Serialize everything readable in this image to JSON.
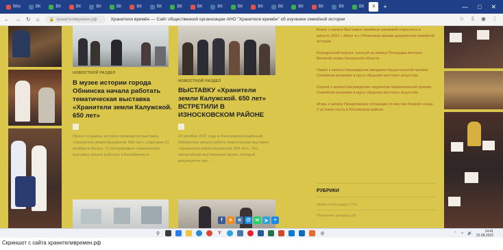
{
  "browser": {
    "tabs": [
      {
        "label": "ВКи"
      },
      {
        "label": "ВК"
      },
      {
        "label": "ВК"
      },
      {
        "label": "ВК"
      },
      {
        "label": "ВК"
      },
      {
        "label": "ВК"
      },
      {
        "label": "ВК"
      },
      {
        "label": "ВК"
      },
      {
        "label": "ВК"
      },
      {
        "label": "ВК"
      },
      {
        "label": "ВК"
      },
      {
        "label": "ВК"
      },
      {
        "label": "ВК"
      },
      {
        "label": "ВК"
      },
      {
        "label": "ВК"
      },
      {
        "label": "ВК"
      },
      {
        "label": "ВК"
      },
      {
        "label": "ВК"
      }
    ],
    "active_tab": "Х",
    "window_controls": {
      "minimize": "—",
      "maximize": "□",
      "close": "✕"
    },
    "url": "хранителивремен.рф",
    "page_title": "Хранители времён — Сайт общественной организации АНО \"Хранители времён\" об изучении семейной истории"
  },
  "articles": [
    {
      "category": "НОВОСТНОЙ РАЗДЕЛ",
      "title": "В музее истории города Обнинска начала работать тематическая выставка «Хранители земли Калужской. 650 лет»",
      "excerpt": "Проект, в рамках которого проводится выставка «Хранители земли Калужской. 650 лет», стартовал 21 октября в Калуге. 12 интерактивно-тематических выставка начала работать в Балабаново и ..."
    },
    {
      "category": "НОВОСТНОЙ РАЗДЕЛ",
      "title": "ВЫСТАВКУ «Хранители земли Калужской. 650 лет» ВСТРЕТИЛИ В ИЗНОСКОВСКОМ РАЙОНЕ",
      "excerpt": "23 октября 2021 года в Износковской районной библиотеке начала работу тематическая выставка «Хранители земли Калужской. 650 лет». Это масштабный выставочный проект, который реализуется при ..."
    }
  ],
  "sidebar": {
    "links": [
      "Борис к записи Выставка семейных реликвий открылась в августе 2021 г. Кипут в к Обнинском архиве документов семейной истории",
      "Бородинский портал. голосуй за записи Площадка ветеран Великой славы Калужской области",
      "Павел к записи Награждение звездами Национальной премии Семейная реликвия в кругу общения местного искусства",
      "Сергей к записи Награждение лауреатов Национальной премии Семейная реликвия в кругу общения местного искусства",
      "Игорь к записи Продолжение площадки по местам боевой славы. У истоков поста в Юхновском районе"
    ],
    "rubrics_title": "РУБРИКИ",
    "rubrics": [
      "Новостной раздел (75)",
      "Полезные ресурсы (6)"
    ]
  },
  "share_buttons": [
    {
      "icon": "facebook-icon",
      "glyph": "f",
      "color": "#3b5998"
    },
    {
      "icon": "ok-icon",
      "glyph": "о",
      "color": "#f08a21"
    },
    {
      "icon": "vk-icon",
      "glyph": "в",
      "color": "#4a76a8"
    },
    {
      "icon": "mail-icon",
      "glyph": "@",
      "color": "#168de2"
    },
    {
      "icon": "whatsapp-icon",
      "glyph": "w",
      "color": "#25d366"
    },
    {
      "icon": "telegram-icon",
      "glyph": "➤",
      "color": "#2aa3df"
    },
    {
      "icon": "plus-icon",
      "glyph": "+",
      "color": "#1e88e5"
    }
  ],
  "taskbar": {
    "time": "14:41",
    "date": "22.08.2022"
  },
  "caption": "Скриншот с сайта хранителивремен.рф"
}
